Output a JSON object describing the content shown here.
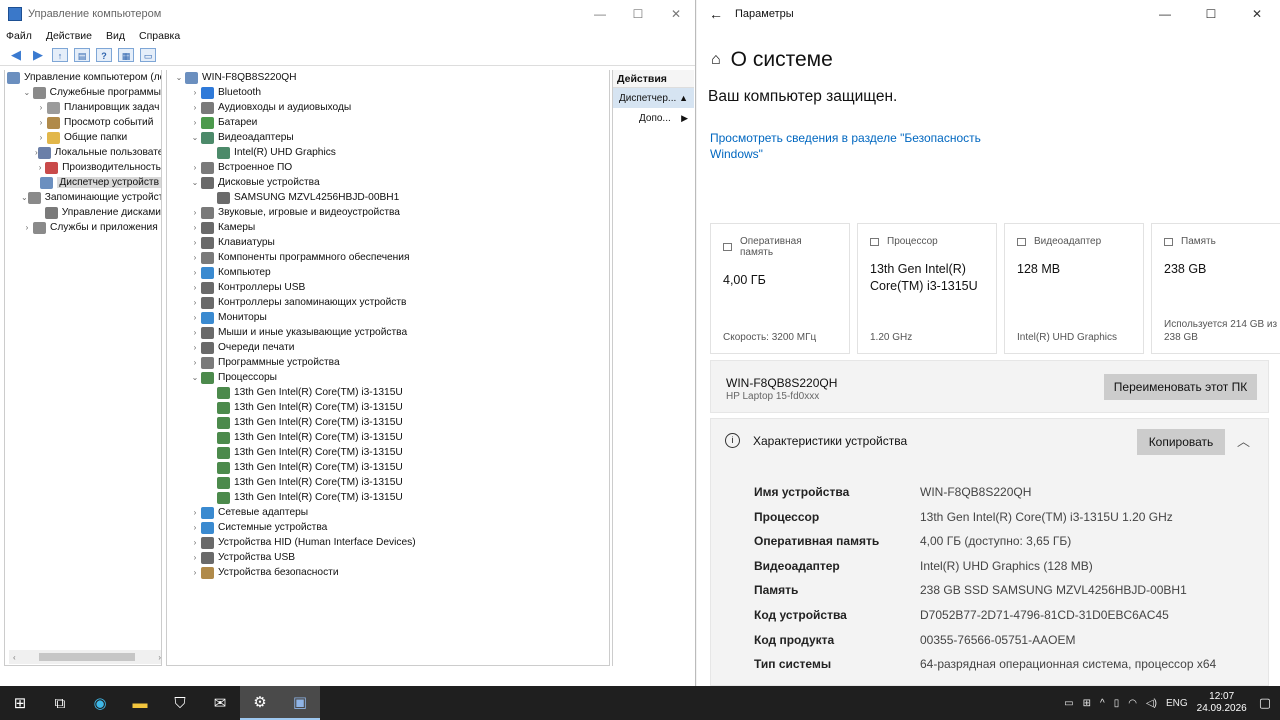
{
  "cm": {
    "title": "Управление компьютером",
    "menu": [
      "Файл",
      "Действие",
      "Вид",
      "Справка"
    ],
    "tree": [
      {
        "label": "Управление компьютером (лс",
        "indent": 0,
        "arrow": "",
        "color": "#6b8fbf"
      },
      {
        "label": "Служебные программы",
        "indent": 1,
        "arrow": "⌄",
        "color": "#8a8a8a"
      },
      {
        "label": "Планировщик задач",
        "indent": 2,
        "arrow": "›",
        "color": "#9b9b9b"
      },
      {
        "label": "Просмотр событий",
        "indent": 2,
        "arrow": "›",
        "color": "#b08a4a"
      },
      {
        "label": "Общие папки",
        "indent": 2,
        "arrow": "›",
        "color": "#e2b74a"
      },
      {
        "label": "Локальные пользовате",
        "indent": 2,
        "arrow": "›",
        "color": "#6b7fa8"
      },
      {
        "label": "Производительность",
        "indent": 2,
        "arrow": "›",
        "color": "#c94a4a"
      },
      {
        "label": "Диспетчер устройств",
        "indent": 2,
        "arrow": "",
        "color": "#6b8fbf",
        "selected": true
      },
      {
        "label": "Запоминающие устройства",
        "indent": 1,
        "arrow": "⌄",
        "color": "#8a8a8a"
      },
      {
        "label": "Управление дисками",
        "indent": 2,
        "arrow": "",
        "color": "#7a7a7a"
      },
      {
        "label": "Службы и приложения",
        "indent": 1,
        "arrow": "›",
        "color": "#8a8a8a"
      }
    ],
    "device_root": "WIN-F8QB8S220QH",
    "devices": [
      {
        "label": "Bluetooth",
        "indent": 1,
        "arrow": "›",
        "color": "#2f7ad9"
      },
      {
        "label": "Аудиовходы и аудиовыходы",
        "indent": 1,
        "arrow": "›",
        "color": "#7a7a7a"
      },
      {
        "label": "Батареи",
        "indent": 1,
        "arrow": "›",
        "color": "#4c9a4c"
      },
      {
        "label": "Видеоадаптеры",
        "indent": 1,
        "arrow": "⌄",
        "color": "#4c8a6a"
      },
      {
        "label": "Intel(R) UHD Graphics",
        "indent": 2,
        "arrow": "",
        "color": "#4c8a6a"
      },
      {
        "label": "Встроенное ПО",
        "indent": 1,
        "arrow": "›",
        "color": "#7a7a7a"
      },
      {
        "label": "Дисковые устройства",
        "indent": 1,
        "arrow": "⌄",
        "color": "#6a6a6a"
      },
      {
        "label": "SAMSUNG MZVL4256HBJD-00BH1",
        "indent": 2,
        "arrow": "",
        "color": "#6a6a6a"
      },
      {
        "label": "Звуковые, игровые и видеоустройства",
        "indent": 1,
        "arrow": "›",
        "color": "#7a7a7a"
      },
      {
        "label": "Камеры",
        "indent": 1,
        "arrow": "›",
        "color": "#6a6a6a"
      },
      {
        "label": "Клавиатуры",
        "indent": 1,
        "arrow": "›",
        "color": "#6a6a6a"
      },
      {
        "label": "Компоненты программного обеспечения",
        "indent": 1,
        "arrow": "›",
        "color": "#7a7a7a"
      },
      {
        "label": "Компьютер",
        "indent": 1,
        "arrow": "›",
        "color": "#3a8ad0"
      },
      {
        "label": "Контроллеры USB",
        "indent": 1,
        "arrow": "›",
        "color": "#6a6a6a"
      },
      {
        "label": "Контроллеры запоминающих устройств",
        "indent": 1,
        "arrow": "›",
        "color": "#6a6a6a"
      },
      {
        "label": "Мониторы",
        "indent": 1,
        "arrow": "›",
        "color": "#3a8ad0"
      },
      {
        "label": "Мыши и иные указывающие устройства",
        "indent": 1,
        "arrow": "›",
        "color": "#6a6a6a"
      },
      {
        "label": "Очереди печати",
        "indent": 1,
        "arrow": "›",
        "color": "#6a6a6a"
      },
      {
        "label": "Программные устройства",
        "indent": 1,
        "arrow": "›",
        "color": "#7a7a7a"
      },
      {
        "label": "Процессоры",
        "indent": 1,
        "arrow": "⌄",
        "color": "#4c8a4c"
      },
      {
        "label": "13th Gen Intel(R) Core(TM) i3-1315U",
        "indent": 2,
        "arrow": "",
        "color": "#4c8a4c"
      },
      {
        "label": "13th Gen Intel(R) Core(TM) i3-1315U",
        "indent": 2,
        "arrow": "",
        "color": "#4c8a4c"
      },
      {
        "label": "13th Gen Intel(R) Core(TM) i3-1315U",
        "indent": 2,
        "arrow": "",
        "color": "#4c8a4c"
      },
      {
        "label": "13th Gen Intel(R) Core(TM) i3-1315U",
        "indent": 2,
        "arrow": "",
        "color": "#4c8a4c"
      },
      {
        "label": "13th Gen Intel(R) Core(TM) i3-1315U",
        "indent": 2,
        "arrow": "",
        "color": "#4c8a4c"
      },
      {
        "label": "13th Gen Intel(R) Core(TM) i3-1315U",
        "indent": 2,
        "arrow": "",
        "color": "#4c8a4c"
      },
      {
        "label": "13th Gen Intel(R) Core(TM) i3-1315U",
        "indent": 2,
        "arrow": "",
        "color": "#4c8a4c"
      },
      {
        "label": "13th Gen Intel(R) Core(TM) i3-1315U",
        "indent": 2,
        "arrow": "",
        "color": "#4c8a4c"
      },
      {
        "label": "Сетевые адаптеры",
        "indent": 1,
        "arrow": "›",
        "color": "#3a8ad0"
      },
      {
        "label": "Системные устройства",
        "indent": 1,
        "arrow": "›",
        "color": "#3a8ad0"
      },
      {
        "label": "Устройства HID (Human Interface Devices)",
        "indent": 1,
        "arrow": "›",
        "color": "#6a6a6a"
      },
      {
        "label": "Устройства USB",
        "indent": 1,
        "arrow": "›",
        "color": "#6a6a6a"
      },
      {
        "label": "Устройства безопасности",
        "indent": 1,
        "arrow": "›",
        "color": "#b08a4a"
      }
    ],
    "actions_title": "Действия",
    "action_primary": "Диспетчер...",
    "action_more": "Допо..."
  },
  "settings": {
    "title": "Параметры",
    "heading": "О системе",
    "protect": "Ваш компьютер защищен.",
    "link": "Просмотреть сведения в разделе \"Безопасность Windows\"",
    "cards": [
      {
        "title": "Оперативная память",
        "value": "4,00 ГБ",
        "sub": "Скорость: 3200 МГц"
      },
      {
        "title": "Процессор",
        "value": "13th Gen Intel(R) Core(TM) i3-1315U",
        "sub": "1.20 GHz"
      },
      {
        "title": "Видеоадаптер",
        "value": "128 MB",
        "sub": "Intel(R) UHD Graphics"
      },
      {
        "title": "Память",
        "value": "238 GB",
        "sub": "Используется 214 GB из 238 GB"
      }
    ],
    "pc_name": "WIN-F8QB8S220QH",
    "pc_model": "HP Laptop 15-fd0xxx",
    "rename_label": "Переименовать этот ПК",
    "spec_title": "Характеристики устройства",
    "copy_label": "Копировать",
    "specs": [
      {
        "k": "Имя устройства",
        "v": "WIN-F8QB8S220QH"
      },
      {
        "k": "Процессор",
        "v": "13th Gen Intel(R) Core(TM) i3-1315U   1.20 GHz"
      },
      {
        "k": "Оперативная память",
        "v": "4,00 ГБ (доступно: 3,65 ГБ)"
      },
      {
        "k": "Видеоадаптер",
        "v": "Intel(R) UHD Graphics (128 MB)"
      },
      {
        "k": "Память",
        "v": "238 GB SSD SAMSUNG MZVL4256HBJD-00BH1"
      },
      {
        "k": "Код устройства",
        "v": "D7052B77-2D71-4796-81CD-31D0EBC6AC45"
      },
      {
        "k": "Код продукта",
        "v": "00355-76566-05751-AAOEM"
      },
      {
        "k": "Тип системы",
        "v": "64-разрядная операционная система, процессор x64"
      }
    ]
  },
  "taskbar": {
    "lang": "ENG",
    "time": "12:07",
    "date": "24.09.2026"
  }
}
